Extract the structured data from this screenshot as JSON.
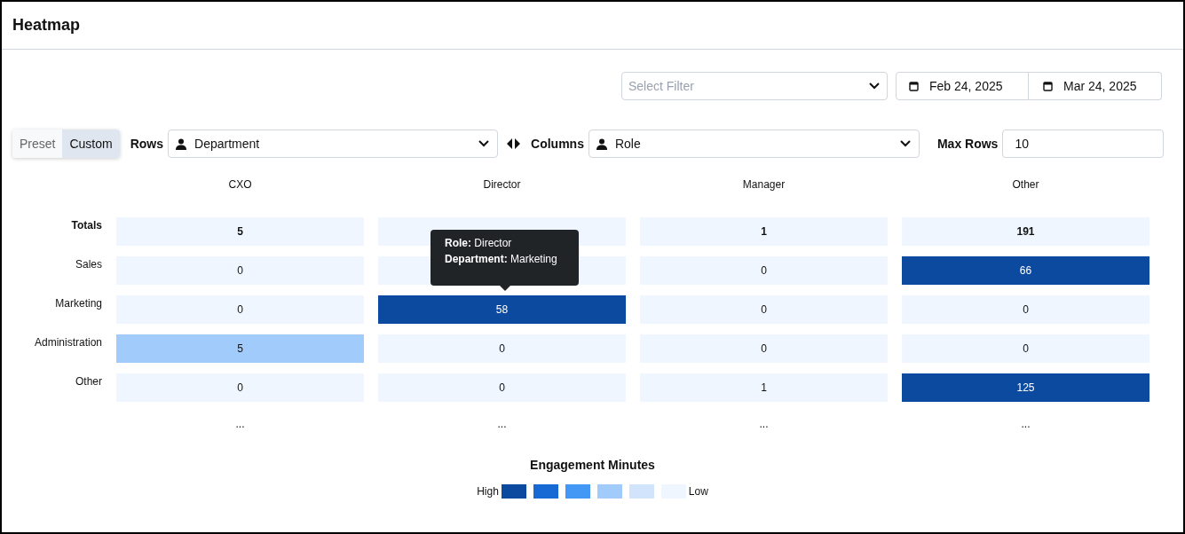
{
  "title": "Heatmap",
  "filter": {
    "placeholder": "Select Filter"
  },
  "date_range": {
    "start": "Feb 24, 2025",
    "end": "Mar 24, 2025"
  },
  "mode_toggle": [
    {
      "label": "Preset",
      "selected": false
    },
    {
      "label": "Custom",
      "selected": true
    }
  ],
  "rows_select": {
    "label": "Rows",
    "value": "Department"
  },
  "columns_select": {
    "label": "Columns",
    "value": "Role"
  },
  "max_rows": {
    "label": "Max Rows",
    "value": "10"
  },
  "heatmap": {
    "columns": [
      "CXO",
      "Director",
      "Manager",
      "Other"
    ],
    "rows": [
      {
        "label": "Totals",
        "kind": "total",
        "cells": [
          {
            "value": "5",
            "color": "#eff6ff"
          },
          {
            "color": "#eff6ff"
          },
          {
            "value": "1",
            "color": "#eff6ff"
          },
          {
            "value": "191",
            "color": "#eff6ff"
          }
        ]
      },
      {
        "label": "Sales",
        "kind": "data",
        "cells": [
          {
            "value": "0",
            "color": "#eff6ff"
          },
          {
            "color": "#eff6ff"
          },
          {
            "value": "0",
            "color": "#eff6ff"
          },
          {
            "value": "66",
            "color": "#0b4a9e"
          }
        ]
      },
      {
        "label": "Marketing",
        "kind": "data",
        "cells": [
          {
            "value": "0",
            "color": "#eff6ff"
          },
          {
            "value": "58",
            "color": "#0b4a9e"
          },
          {
            "value": "0",
            "color": "#eff6ff"
          },
          {
            "value": "0",
            "color": "#eff6ff"
          }
        ]
      },
      {
        "label": "Administration",
        "kind": "data",
        "cells": [
          {
            "value": "5",
            "color": "#a0cbfa"
          },
          {
            "value": "0",
            "color": "#eff6ff"
          },
          {
            "value": "0",
            "color": "#eff6ff"
          },
          {
            "value": "0",
            "color": "#eff6ff"
          }
        ]
      },
      {
        "label": "Other",
        "kind": "data",
        "cells": [
          {
            "value": "0",
            "color": "#eff6ff"
          },
          {
            "value": "0",
            "color": "#eff6ff"
          },
          {
            "value": "1",
            "color": "#eff6ff"
          },
          {
            "value": "125",
            "color": "#0b4a9e"
          }
        ]
      }
    ],
    "more": [
      "...",
      "...",
      "...",
      "..."
    ]
  },
  "tooltip": {
    "lines": [
      "**Role:** Director",
      "**Department:** Marketing"
    ]
  },
  "legend": {
    "title": "Engagement Minutes",
    "high_label": "High",
    "low_label": "Low",
    "swatches": [
      {
        "color": "#0b4a9e"
      },
      {
        "color": "#1769d4"
      },
      {
        "color": "#4498f5"
      },
      {
        "color": "#a0cbfa"
      },
      {
        "color": "#d1e4fc"
      },
      {
        "color": "#eff6ff"
      }
    ]
  }
}
